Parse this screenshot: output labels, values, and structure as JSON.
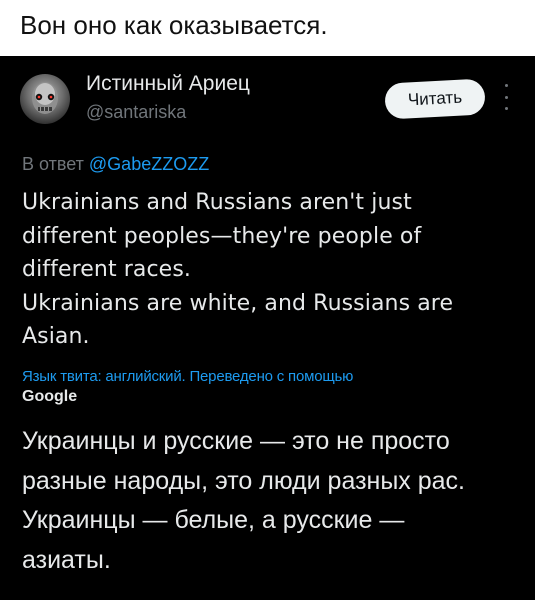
{
  "caption": "Вон оно как оказывается.",
  "author": {
    "display_name": "Истинный Ариец",
    "handle": "@santariska",
    "avatar_icon": "terminator-skull-icon"
  },
  "follow_button_label": "Читать",
  "more_icon": "more-vertical-icon",
  "reply": {
    "prefix": "В ответ",
    "mention": "@GabeZZOZZ"
  },
  "tweet_lines": [
    "Ukrainians and Russians aren't just",
    "different peoples—they're people of",
    "different races.",
    "Ukrainians are white, and Russians are",
    "Asian."
  ],
  "translation_note": "Язык твита: английский. Переведено с помощью",
  "translation_provider": "Google",
  "translated_lines": [
    "Украинцы и русские — это не просто",
    "разные народы, это люди разных рас.",
    "Украинцы — белые, а русские —",
    "азиаты."
  ],
  "colors": {
    "background": "#000000",
    "text": "#e7e9ea",
    "secondary": "#71767b",
    "link": "#1d9bf0",
    "button_bg": "#eff3f4"
  }
}
